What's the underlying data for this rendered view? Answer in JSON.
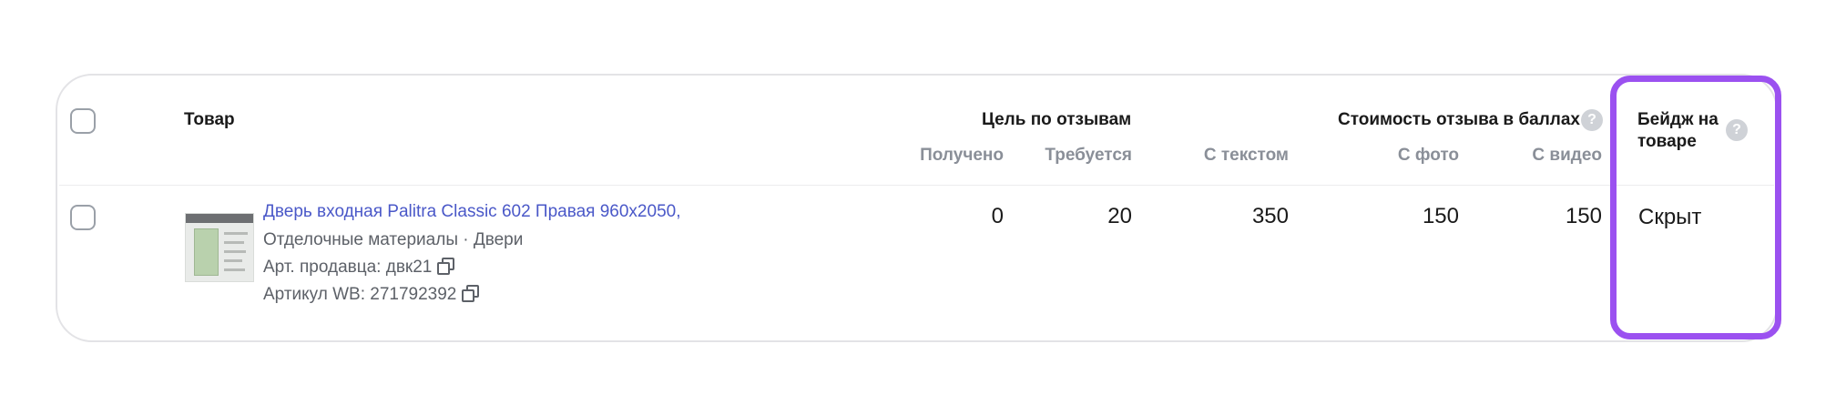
{
  "header": {
    "product": "Товар",
    "goal_group": "Цель по отзывам",
    "received": "Получено",
    "required": "Требуется",
    "cost_group": "Стоимость отзыва в баллах",
    "with_text": "С текстом",
    "with_photo": "С фото",
    "with_video": "С видео",
    "badge_line1": "Бейдж на",
    "badge_line2": "товаре",
    "help_glyph": "?"
  },
  "row": {
    "title": "Дверь входная Palitra Classic 602 Правая 960x2050,",
    "category": "Отделочные материалы · Двери",
    "seller_article": "Арт. продавца: двк21",
    "wb_article": "Артикул WB: 271792392",
    "received": "0",
    "required": "20",
    "cost_text": "350",
    "cost_photo": "150",
    "cost_video": "150",
    "badge_status": "Скрыт"
  },
  "colors": {
    "link": "#4a58c8",
    "highlight": "#9b51f0",
    "border": "#e3e3e6",
    "muted": "#8a8f98"
  },
  "icons": [
    "checkbox",
    "help-icon",
    "copy-icon",
    "product-thumbnail"
  ]
}
